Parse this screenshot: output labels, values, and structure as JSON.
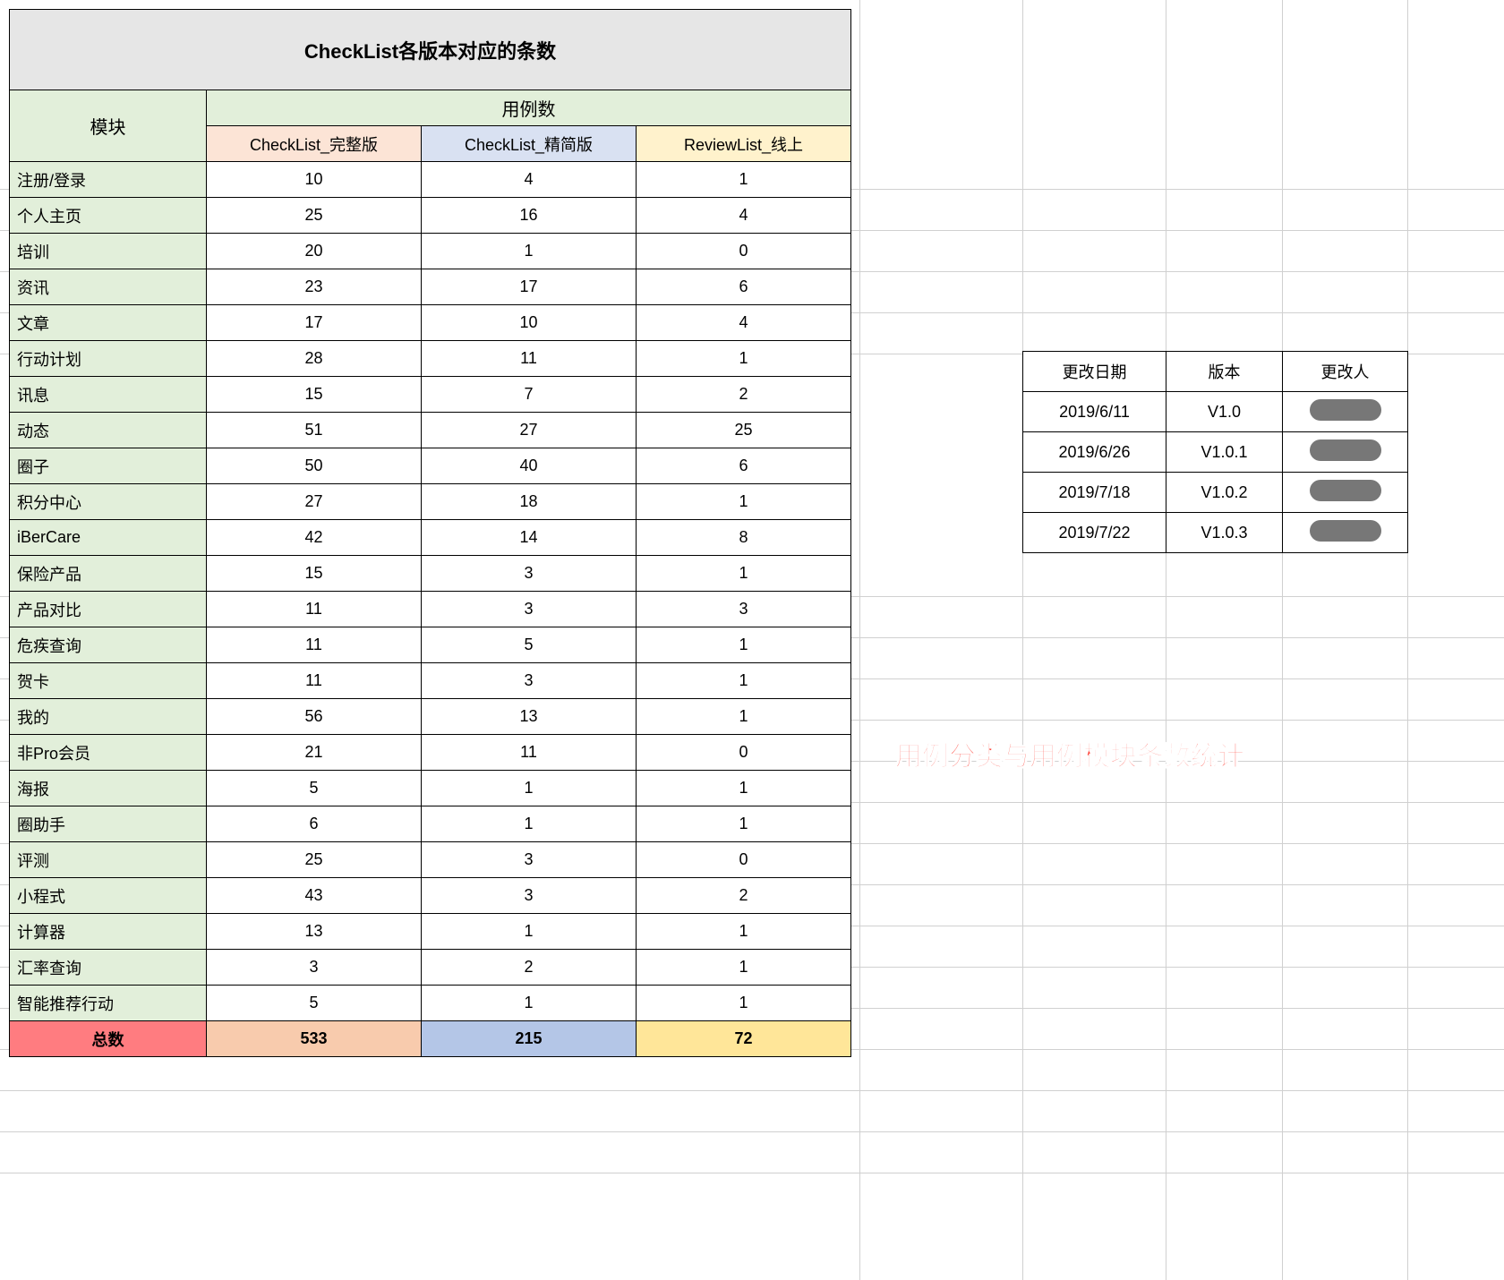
{
  "title": "CheckList各版本对应的条数",
  "headers": {
    "module": "模块",
    "usecase": "用例数",
    "full": "CheckList_完整版",
    "simple": "CheckList_精简版",
    "review": "ReviewList_线上"
  },
  "rows": [
    {
      "module": "注册/登录",
      "full": "10",
      "simple": "4",
      "review": "1"
    },
    {
      "module": "个人主页",
      "full": "25",
      "simple": "16",
      "review": "4"
    },
    {
      "module": "培训",
      "full": "20",
      "simple": "1",
      "review": "0"
    },
    {
      "module": "资讯",
      "full": "23",
      "simple": "17",
      "review": "6"
    },
    {
      "module": "文章",
      "full": "17",
      "simple": "10",
      "review": "4"
    },
    {
      "module": "行动计划",
      "full": "28",
      "simple": "11",
      "review": "1"
    },
    {
      "module": "讯息",
      "full": "15",
      "simple": "7",
      "review": "2"
    },
    {
      "module": "动态",
      "full": "51",
      "simple": "27",
      "review": "25"
    },
    {
      "module": "圈子",
      "full": "50",
      "simple": "40",
      "review": "6"
    },
    {
      "module": "积分中心",
      "full": "27",
      "simple": "18",
      "review": "1"
    },
    {
      "module": "iBerCare",
      "full": "42",
      "simple": "14",
      "review": "8"
    },
    {
      "module": "保险产品",
      "full": "15",
      "simple": "3",
      "review": "1"
    },
    {
      "module": "产品对比",
      "full": "11",
      "simple": "3",
      "review": "3"
    },
    {
      "module": "危疾查询",
      "full": "11",
      "simple": "5",
      "review": "1"
    },
    {
      "module": "贺卡",
      "full": "11",
      "simple": "3",
      "review": "1"
    },
    {
      "module": "我的",
      "full": "56",
      "simple": "13",
      "review": "1"
    },
    {
      "module": "非Pro会员",
      "full": "21",
      "simple": "11",
      "review": "0"
    },
    {
      "module": "海报",
      "full": "5",
      "simple": "1",
      "review": "1"
    },
    {
      "module": "圈助手",
      "full": "6",
      "simple": "1",
      "review": "1"
    },
    {
      "module": "评测",
      "full": "25",
      "simple": "3",
      "review": "0"
    },
    {
      "module": "小程式",
      "full": "43",
      "simple": "3",
      "review": "2"
    },
    {
      "module": "计算器",
      "full": "13",
      "simple": "1",
      "review": "1"
    },
    {
      "module": "汇率查询",
      "full": "3",
      "simple": "2",
      "review": "1"
    },
    {
      "module": "智能推荐行动",
      "full": "5",
      "simple": "1",
      "review": "1"
    }
  ],
  "totals": {
    "label": "总数",
    "full": "533",
    "simple": "215",
    "review": "72"
  },
  "version_headers": {
    "date": "更改日期",
    "version": "版本",
    "author": "更改人"
  },
  "version_rows": [
    {
      "date": "2019/6/11",
      "version": "V1.0"
    },
    {
      "date": "2019/6/26",
      "version": "V1.0.1"
    },
    {
      "date": "2019/7/18",
      "version": "V1.0.2"
    },
    {
      "date": "2019/7/22",
      "version": "V1.0.3"
    }
  ],
  "annotation": "用例分类与用例模块条数统计",
  "chart_data": {
    "type": "table",
    "title": "CheckList各版本对应的条数",
    "columns": [
      "模块",
      "CheckList_完整版",
      "CheckList_精简版",
      "ReviewList_线上"
    ],
    "rows": [
      [
        "注册/登录",
        10,
        4,
        1
      ],
      [
        "个人主页",
        25,
        16,
        4
      ],
      [
        "培训",
        20,
        1,
        0
      ],
      [
        "资讯",
        23,
        17,
        6
      ],
      [
        "文章",
        17,
        10,
        4
      ],
      [
        "行动计划",
        28,
        11,
        1
      ],
      [
        "讯息",
        15,
        7,
        2
      ],
      [
        "动态",
        51,
        27,
        25
      ],
      [
        "圈子",
        50,
        40,
        6
      ],
      [
        "积分中心",
        27,
        18,
        1
      ],
      [
        "iBerCare",
        42,
        14,
        8
      ],
      [
        "保险产品",
        15,
        3,
        1
      ],
      [
        "产品对比",
        11,
        3,
        3
      ],
      [
        "危疾查询",
        11,
        5,
        1
      ],
      [
        "贺卡",
        11,
        3,
        1
      ],
      [
        "我的",
        56,
        13,
        1
      ],
      [
        "非Pro会员",
        21,
        11,
        0
      ],
      [
        "海报",
        5,
        1,
        1
      ],
      [
        "圈助手",
        6,
        1,
        1
      ],
      [
        "评测",
        25,
        3,
        0
      ],
      [
        "小程式",
        43,
        3,
        2
      ],
      [
        "计算器",
        13,
        1,
        1
      ],
      [
        "汇率查询",
        3,
        2,
        1
      ],
      [
        "智能推荐行动",
        5,
        1,
        1
      ]
    ],
    "totals": [
      533,
      215,
      72
    ]
  }
}
